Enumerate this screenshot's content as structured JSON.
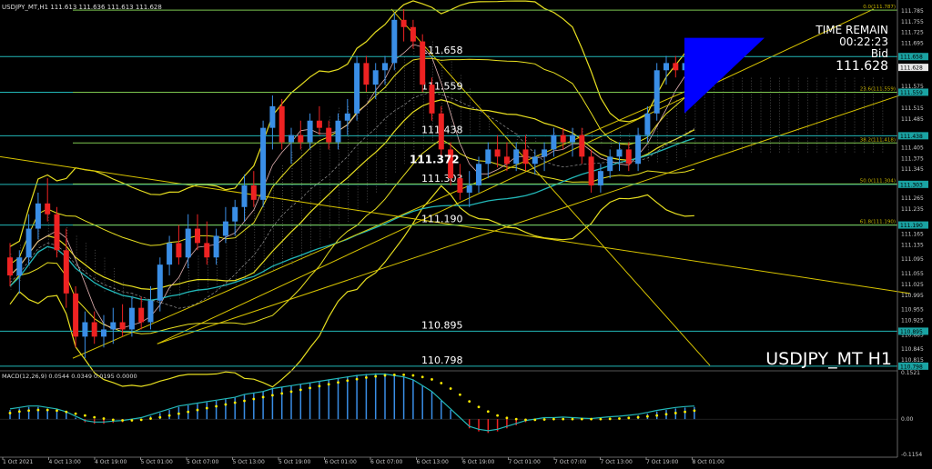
{
  "header": {
    "symbol_line": "USDJPY_MT,H1  111.613 111.636 111.613 111.628"
  },
  "macd_header": "MACD(12,26,9) 0.0544 0.0349 0.0195 0.0000",
  "watermark": "USDJPY_MT H1",
  "time_remain": {
    "label": "TIME REMAIN",
    "value": "00:22:23",
    "bid_label": "Bid",
    "bid_value": "111.628"
  },
  "price_axis": [
    {
      "price": 111.785,
      "text": "111.785"
    },
    {
      "price": 111.755,
      "text": "111.755"
    },
    {
      "price": 111.725,
      "text": "111.725"
    },
    {
      "price": 111.695,
      "text": "111.695"
    },
    {
      "price": 111.575,
      "text": "111.575"
    },
    {
      "price": 111.515,
      "text": "111.515"
    },
    {
      "price": 111.485,
      "text": "111.485"
    },
    {
      "price": 111.405,
      "text": "111.405"
    },
    {
      "price": 111.375,
      "text": "111.375"
    },
    {
      "price": 111.345,
      "text": "111.345"
    },
    {
      "price": 111.265,
      "text": "111.265"
    },
    {
      "price": 111.235,
      "text": "111.235"
    },
    {
      "price": 111.165,
      "text": "111.165"
    },
    {
      "price": 111.135,
      "text": "111.135"
    },
    {
      "price": 111.095,
      "text": "111.095"
    },
    {
      "price": 111.055,
      "text": "111.055"
    },
    {
      "price": 111.025,
      "text": "111.025"
    },
    {
      "price": 110.995,
      "text": "110.995"
    },
    {
      "price": 110.955,
      "text": "110.955"
    },
    {
      "price": 110.925,
      "text": "110.925"
    },
    {
      "price": 110.885,
      "text": "110.885"
    },
    {
      "price": 110.845,
      "text": "110.845"
    },
    {
      "price": 110.815,
      "text": "110.815"
    }
  ],
  "price_tags": [
    {
      "price": 111.658,
      "text": "111.658",
      "color": "#1aa3a3"
    },
    {
      "price": 111.628,
      "text": "111.628",
      "color": "#e8e8e8"
    },
    {
      "price": 111.559,
      "text": "111.559",
      "color": "#1aa3a3"
    },
    {
      "price": 111.438,
      "text": "111.438",
      "color": "#1aa3a3"
    },
    {
      "price": 111.303,
      "text": "111.303",
      "color": "#1aa3a3"
    },
    {
      "price": 111.19,
      "text": "111.190",
      "color": "#1aa3a3"
    },
    {
      "price": 110.895,
      "text": "110.895",
      "color": "#1aa3a3"
    },
    {
      "price": 110.798,
      "text": "110.798",
      "color": "#1aa3a3"
    }
  ],
  "level_labels": [
    {
      "price": 111.658,
      "text": "111.658"
    },
    {
      "price": 111.559,
      "text": "111.559"
    },
    {
      "price": 111.438,
      "text": "111.438"
    },
    {
      "price": 111.303,
      "text": "111.303"
    },
    {
      "price": 111.19,
      "text": "111.190"
    },
    {
      "price": 110.895,
      "text": "110.895"
    },
    {
      "price": 110.798,
      "text": "110.798"
    }
  ],
  "current_marker": {
    "price": 111.372,
    "text": "111.372"
  },
  "fib_levels": [
    {
      "price": 111.787,
      "text": "0.0(111.787)"
    },
    {
      "price": 111.559,
      "text": "23.6(111.559)"
    },
    {
      "price": 111.418,
      "text": "38.2(111.418)"
    },
    {
      "price": 111.304,
      "text": "50.0(111.304)"
    },
    {
      "price": 111.19,
      "text": "61.8(111.190)"
    }
  ],
  "macd_axis": [
    {
      "value": 0.1521,
      "text": "0.1521"
    },
    {
      "value": 0.0,
      "text": "0.00"
    },
    {
      "value": -0.1154,
      "text": "-0.1154"
    }
  ],
  "time_axis": [
    "1 Oct 2021",
    "4 Oct 13:00",
    "4 Oct 19:00",
    "5 Oct 01:00",
    "5 Oct 07:00",
    "5 Oct 13:00",
    "5 Oct 19:00",
    "6 Oct 01:00",
    "6 Oct 07:00",
    "6 Oct 13:00",
    "6 Oct 19:00",
    "7 Oct 01:00",
    "7 Oct 07:00",
    "7 Oct 13:00",
    "7 Oct 19:00",
    "8 Oct 01:00"
  ],
  "colors": {
    "background": "#000000",
    "bull": "#3a8ee6",
    "bear": "#ee2222",
    "yellow": "#e8e020",
    "cyan": "#22b8b8",
    "green_level": "#7ec850",
    "fib": "#c8b400",
    "macd_signal": "#ffee00",
    "triangle": "#0000ff"
  },
  "chart_data": {
    "type": "candlestick",
    "timeframe": "H1",
    "ohlc": [
      [
        111.1,
        111.14,
        111.02,
        111.05
      ],
      [
        111.05,
        111.12,
        111.0,
        111.1
      ],
      [
        111.1,
        111.22,
        111.08,
        111.18
      ],
      [
        111.18,
        111.28,
        111.15,
        111.25
      ],
      [
        111.25,
        111.32,
        111.2,
        111.22
      ],
      [
        111.22,
        111.24,
        111.1,
        111.12
      ],
      [
        111.12,
        111.18,
        110.96,
        111.0
      ],
      [
        111.0,
        111.02,
        110.85,
        110.88
      ],
      [
        110.88,
        110.95,
        110.82,
        110.92
      ],
      [
        110.92,
        110.95,
        110.86,
        110.88
      ],
      [
        110.88,
        110.94,
        110.85,
        110.9
      ],
      [
        110.9,
        110.96,
        110.86,
        110.92
      ],
      [
        110.92,
        110.97,
        110.88,
        110.9
      ],
      [
        110.9,
        110.99,
        110.88,
        110.96
      ],
      [
        110.96,
        110.99,
        110.9,
        110.92
      ],
      [
        110.92,
        111.02,
        110.9,
        110.98
      ],
      [
        110.98,
        111.1,
        110.95,
        111.08
      ],
      [
        111.08,
        111.16,
        111.05,
        111.14
      ],
      [
        111.14,
        111.19,
        111.08,
        111.1
      ],
      [
        111.1,
        111.22,
        111.07,
        111.18
      ],
      [
        111.18,
        111.22,
        111.12,
        111.14
      ],
      [
        111.14,
        111.2,
        111.08,
        111.1
      ],
      [
        111.1,
        111.18,
        111.08,
        111.16
      ],
      [
        111.16,
        111.24,
        111.14,
        111.2
      ],
      [
        111.2,
        111.26,
        111.16,
        111.24
      ],
      [
        111.24,
        111.33,
        111.2,
        111.3
      ],
      [
        111.3,
        111.34,
        111.24,
        111.26
      ],
      [
        111.26,
        111.48,
        111.24,
        111.46
      ],
      [
        111.46,
        111.55,
        111.4,
        111.52
      ],
      [
        111.52,
        111.54,
        111.4,
        111.42
      ],
      [
        111.42,
        111.46,
        111.36,
        111.44
      ],
      [
        111.44,
        111.48,
        111.4,
        111.42
      ],
      [
        111.42,
        111.5,
        111.4,
        111.48
      ],
      [
        111.48,
        111.52,
        111.44,
        111.46
      ],
      [
        111.46,
        111.48,
        111.4,
        111.42
      ],
      [
        111.42,
        111.5,
        111.4,
        111.48
      ],
      [
        111.48,
        111.54,
        111.44,
        111.5
      ],
      [
        111.5,
        111.66,
        111.48,
        111.64
      ],
      [
        111.64,
        111.66,
        111.56,
        111.58
      ],
      [
        111.58,
        111.64,
        111.54,
        111.62
      ],
      [
        111.62,
        111.66,
        111.58,
        111.64
      ],
      [
        111.64,
        111.78,
        111.62,
        111.76
      ],
      [
        111.76,
        111.79,
        111.7,
        111.74
      ],
      [
        111.74,
        111.76,
        111.68,
        111.7
      ],
      [
        111.7,
        111.72,
        111.56,
        111.58
      ],
      [
        111.58,
        111.6,
        111.48,
        111.5
      ],
      [
        111.5,
        111.52,
        111.38,
        111.4
      ],
      [
        111.4,
        111.42,
        111.3,
        111.32
      ],
      [
        111.32,
        111.36,
        111.26,
        111.28
      ],
      [
        111.28,
        111.34,
        111.24,
        111.3
      ],
      [
        111.3,
        111.38,
        111.28,
        111.36
      ],
      [
        111.36,
        111.42,
        111.32,
        111.4
      ],
      [
        111.4,
        111.44,
        111.35,
        111.38
      ],
      [
        111.38,
        111.42,
        111.34,
        111.36
      ],
      [
        111.36,
        111.42,
        111.34,
        111.4
      ],
      [
        111.4,
        111.44,
        111.34,
        111.36
      ],
      [
        111.36,
        111.4,
        111.33,
        111.38
      ],
      [
        111.38,
        111.42,
        111.34,
        111.4
      ],
      [
        111.4,
        111.46,
        111.38,
        111.44
      ],
      [
        111.44,
        111.46,
        111.4,
        111.42
      ],
      [
        111.42,
        111.46,
        111.38,
        111.44
      ],
      [
        111.44,
        111.46,
        111.36,
        111.38
      ],
      [
        111.38,
        111.4,
        111.28,
        111.3
      ],
      [
        111.3,
        111.36,
        111.28,
        111.34
      ],
      [
        111.34,
        111.4,
        111.32,
        111.38
      ],
      [
        111.38,
        111.42,
        111.34,
        111.4
      ],
      [
        111.4,
        111.42,
        111.34,
        111.36
      ],
      [
        111.36,
        111.46,
        111.34,
        111.44
      ],
      [
        111.44,
        111.52,
        111.42,
        111.5
      ],
      [
        111.5,
        111.64,
        111.48,
        111.62
      ],
      [
        111.62,
        111.66,
        111.58,
        111.64
      ],
      [
        111.64,
        111.66,
        111.6,
        111.62
      ],
      [
        111.62,
        111.65,
        111.58,
        111.64
      ],
      [
        111.64,
        111.66,
        111.62,
        111.63
      ]
    ],
    "macd": {
      "name": "MACD(12,26,9)",
      "values_hist": [
        0.03,
        0.035,
        0.04,
        0.04,
        0.035,
        0.03,
        0.02,
        0.005,
        -0.01,
        -0.015,
        -0.015,
        -0.012,
        -0.01,
        -0.005,
        0.0,
        0.01,
        0.02,
        0.03,
        0.04,
        0.045,
        0.05,
        0.055,
        0.06,
        0.065,
        0.07,
        0.08,
        0.085,
        0.09,
        0.1,
        0.105,
        0.11,
        0.115,
        0.12,
        0.125,
        0.13,
        0.135,
        0.14,
        0.145,
        0.148,
        0.15,
        0.15,
        0.145,
        0.14,
        0.13,
        0.11,
        0.09,
        0.06,
        0.03,
        0.0,
        -0.03,
        -0.04,
        -0.045,
        -0.04,
        -0.03,
        -0.02,
        -0.01,
        -0.005,
        0.0,
        0.0,
        0.002,
        0.0,
        -0.002,
        -0.003,
        0.0,
        0.003,
        0.005,
        0.008,
        0.012,
        0.018,
        0.025,
        0.03,
        0.035,
        0.038,
        0.04
      ],
      "signal": [
        0.02,
        0.025,
        0.028,
        0.03,
        0.03,
        0.028,
        0.024,
        0.018,
        0.012,
        0.006,
        0.002,
        -0.002,
        -0.004,
        -0.004,
        -0.002,
        0.002,
        0.006,
        0.012,
        0.018,
        0.024,
        0.03,
        0.036,
        0.042,
        0.048,
        0.054,
        0.06,
        0.066,
        0.072,
        0.078,
        0.084,
        0.09,
        0.096,
        0.102,
        0.108,
        0.114,
        0.12,
        0.126,
        0.131,
        0.136,
        0.14,
        0.143,
        0.145,
        0.145,
        0.143,
        0.138,
        0.13,
        0.118,
        0.1,
        0.08,
        0.058,
        0.04,
        0.025,
        0.012,
        0.004,
        0.0,
        -0.002,
        -0.002,
        -0.001,
        0.0,
        0.0,
        0.0,
        0.0,
        0.0,
        0.0,
        0.001,
        0.002,
        0.004,
        0.006,
        0.009,
        0.012,
        0.016,
        0.02,
        0.024,
        0.028
      ],
      "ylim": [
        -0.1154,
        0.1521
      ]
    },
    "ylim": [
      110.79,
      111.8
    ]
  }
}
